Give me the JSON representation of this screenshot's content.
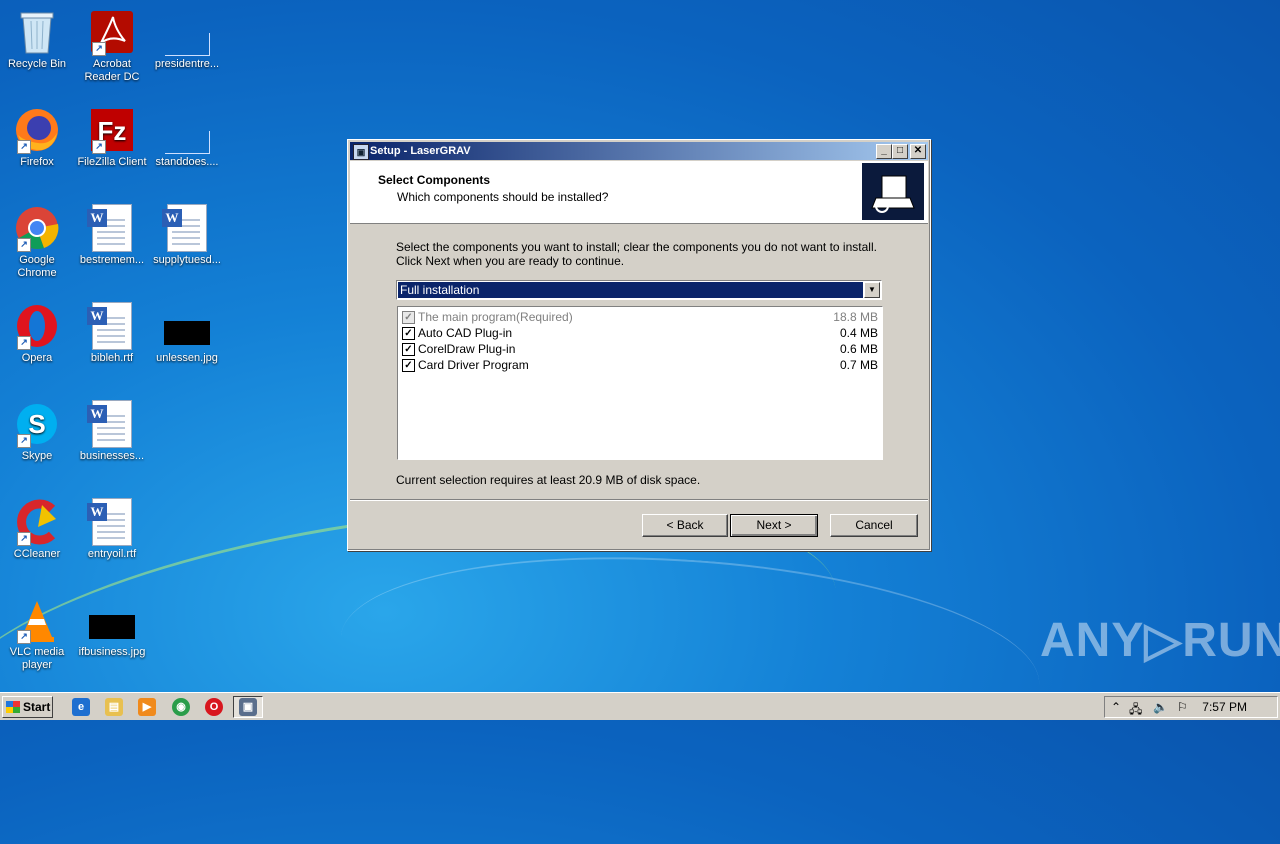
{
  "desktop": {
    "icons": [
      {
        "label": "Recycle Bin"
      },
      {
        "label": "Acrobat Reader DC"
      },
      {
        "label": "presidentre..."
      },
      {
        "label": "Firefox"
      },
      {
        "label": "FileZilla Client"
      },
      {
        "label": "standdoes...."
      },
      {
        "label": "Google Chrome"
      },
      {
        "label": "bestremem..."
      },
      {
        "label": "supplytuesd..."
      },
      {
        "label": "Opera"
      },
      {
        "label": "bibleh.rtf"
      },
      {
        "label": "unlessen.jpg"
      },
      {
        "label": "Skype"
      },
      {
        "label": "businesses..."
      },
      {
        "label": "CCleaner"
      },
      {
        "label": "entryoil.rtf"
      },
      {
        "label": "VLC media player"
      },
      {
        "label": "ifbusiness.jpg"
      }
    ]
  },
  "dialog": {
    "title": "Setup - LaserGRAV",
    "header_title": "Select Components",
    "header_subtitle": "Which components should be installed?",
    "intro": "Select the components you want to install; clear the components you do not want to install. Click Next when you are ready to continue.",
    "install_type": "Full installation",
    "components": [
      {
        "name": "The main program(Required)",
        "size": "18.8 MB",
        "checked": true,
        "disabled": true
      },
      {
        "name": "Auto CAD Plug-in",
        "size": "0.4 MB",
        "checked": true,
        "disabled": false
      },
      {
        "name": "CorelDraw Plug-in",
        "size": "0.6 MB",
        "checked": true,
        "disabled": false
      },
      {
        "name": "Card Driver Program",
        "size": "0.7 MB",
        "checked": true,
        "disabled": false
      }
    ],
    "disk_info": "Current selection requires at least 20.9 MB of disk space.",
    "buttons": {
      "back": "< Back",
      "next": "Next >",
      "cancel": "Cancel"
    },
    "window_controls": {
      "minimize": "_",
      "maximize": "□",
      "close": "✕"
    }
  },
  "taskbar": {
    "start_label": "Start",
    "clock": "7:57 PM"
  },
  "watermark": "ANY▷RUN"
}
